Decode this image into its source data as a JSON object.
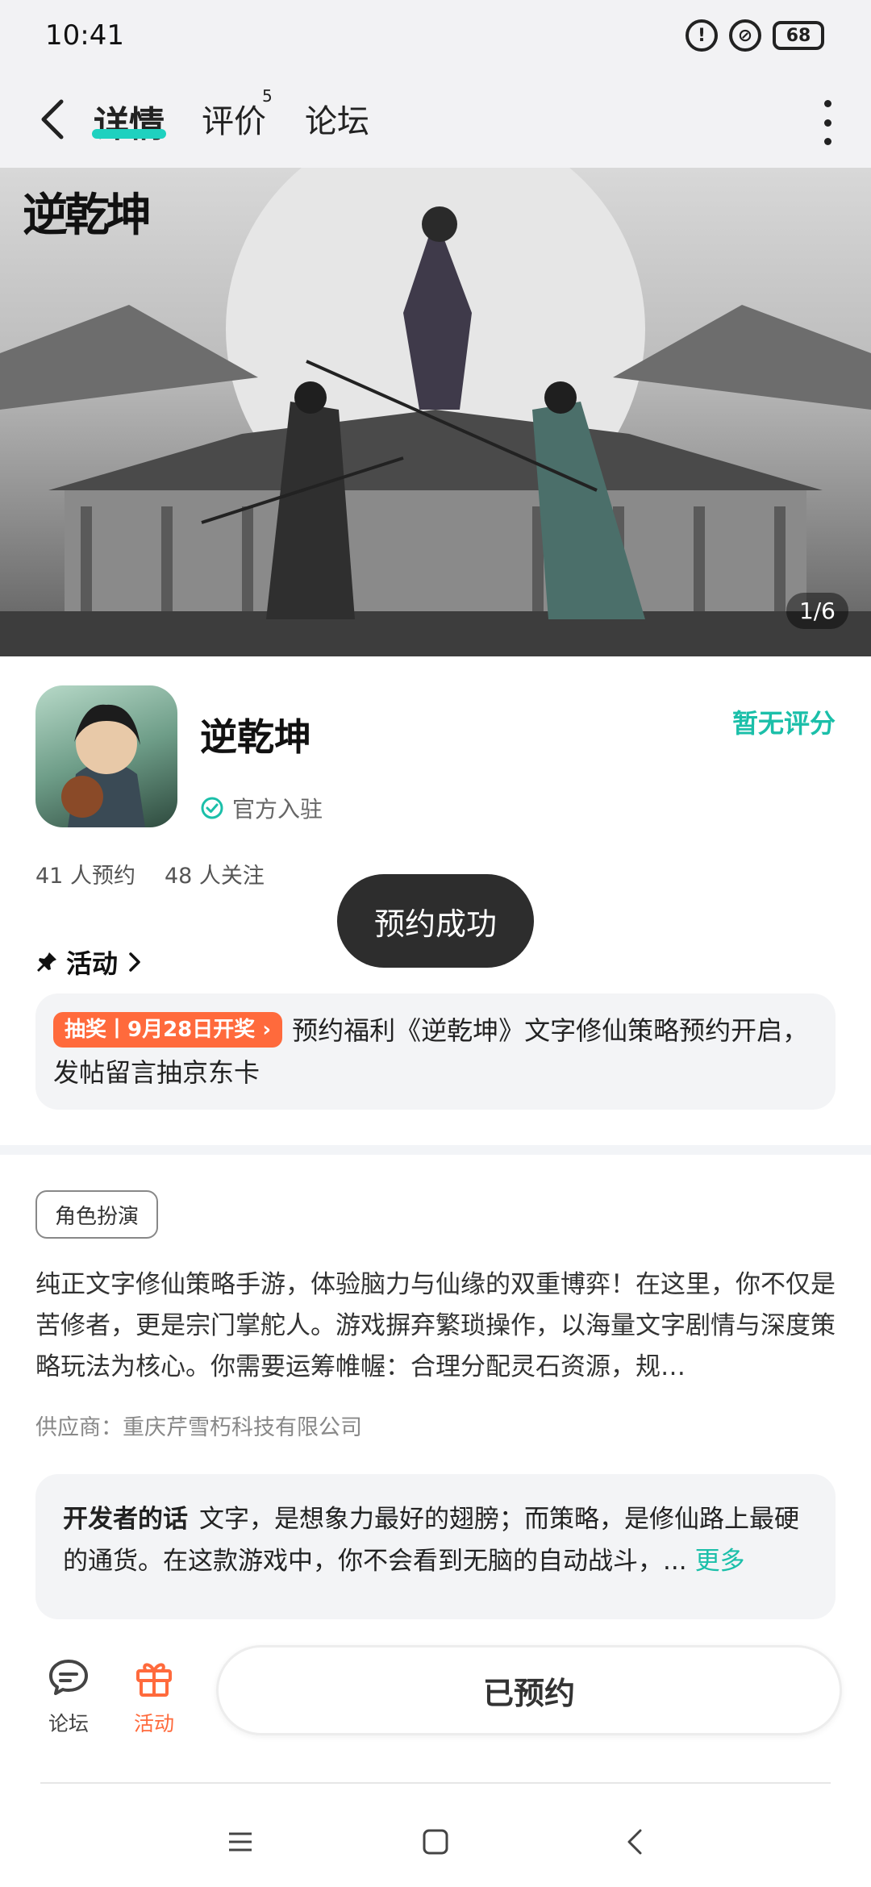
{
  "status_bar": {
    "time": "10:41",
    "battery": "68"
  },
  "nav": {
    "tabs": [
      {
        "label": "详情",
        "active": true
      },
      {
        "label": "评价",
        "badge": "5"
      },
      {
        "label": "论坛"
      }
    ]
  },
  "banner": {
    "logo_text": "逆乾坤",
    "counter": "1/6"
  },
  "app": {
    "name": "逆乾坤",
    "official_label": "官方入驻",
    "rating_text": "暂无评分",
    "reservations": "41 人预约",
    "followers": "48 人关注"
  },
  "toast": {
    "message": "预约成功"
  },
  "activity": {
    "header": "活动",
    "tag": "抽奖丨9月28日开奖",
    "text": "预约福利《逆乾坤》文字修仙策略预约开启，发帖留言抽京东卡"
  },
  "genre_tag": "角色扮演",
  "description": "纯正文字修仙策略手游，体验脑力与仙缘的双重博弈！在这里，你不仅是苦修者，更是宗门掌舵人。游戏摒弃繁琐操作，以海量文字剧情与深度策略玩法为核心。你需要运筹帷幄：合理分配灵石资源，规…",
  "supplier": "供应商：重庆芹雪朽科技有限公司",
  "developer_note": {
    "label": "开发者的话",
    "text": "文字，是想象力最好的翅膀；而策略，是修仙路上最硬的通货。在这款游戏中，你不会看到无脑的自动战斗，...",
    "more": "更多"
  },
  "bottom_bar": {
    "forum_label": "论坛",
    "activity_label": "活动",
    "reserved_label": "已预约"
  },
  "colors": {
    "accent": "#1bbfa9",
    "tab_underline": "#1fd1bf",
    "orange": "#ff6a3c",
    "toast_bg": "#2d2d2d"
  }
}
